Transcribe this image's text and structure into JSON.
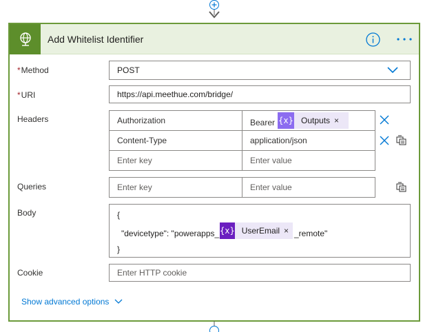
{
  "action": {
    "title": "Add Whitelist Identifier",
    "icon": "globe-icon",
    "accent": "#5d8e2b"
  },
  "fields": {
    "method": {
      "label": "Method",
      "required": "*",
      "value": "POST"
    },
    "uri": {
      "label": "URI",
      "required": "*",
      "value": "https://api.meethue.com/bridge/"
    },
    "headers": {
      "label": "Headers",
      "rows": [
        {
          "key": "Authorization",
          "value_prefix": "Bearer",
          "token": "Outputs"
        },
        {
          "key": "Content-Type",
          "value": "application/json"
        }
      ],
      "key_placeholder": "Enter key",
      "value_placeholder": "Enter value"
    },
    "queries": {
      "label": "Queries",
      "key_placeholder": "Enter key",
      "value_placeholder": "Enter value"
    },
    "body": {
      "label": "Body",
      "line1": "{",
      "line2_prefix": "\"devicetype\": \"powerapps_",
      "line2_token": "UserEmail",
      "line2_suffix": "_remote\"",
      "line3": "}",
      "token_icon": "{x}"
    },
    "cookie": {
      "label": "Cookie",
      "placeholder": "Enter HTTP cookie"
    }
  },
  "advanced_label": "Show advanced options",
  "colors": {
    "card_border": "#6b9a3a",
    "header_bg": "#e9f1e0",
    "link": "#0078d4",
    "token_bg": "#ece7f7",
    "token_icon_light": "#8c6cf0",
    "token_icon_dark": "#6b1fc0"
  }
}
